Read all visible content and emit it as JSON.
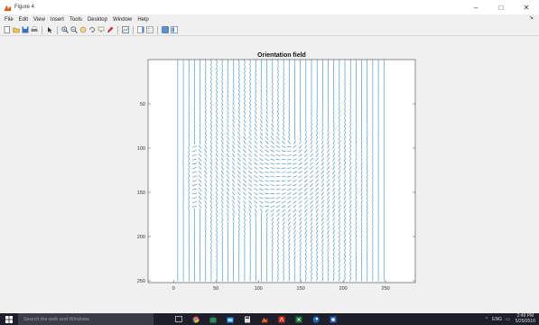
{
  "window": {
    "title": "Figure 4",
    "icon": "matlab-figure-icon",
    "controls": [
      {
        "name": "minimize",
        "glyph": "–"
      },
      {
        "name": "maximize",
        "glyph": "□"
      },
      {
        "name": "close",
        "glyph": "✕"
      }
    ]
  },
  "menubar": {
    "items": [
      "File",
      "Edit",
      "View",
      "Insert",
      "Tools",
      "Desktop",
      "Window",
      "Help"
    ],
    "overflow_glyph": "↘"
  },
  "toolbar": {
    "buttons": [
      "new-figure-icon",
      "open-file-icon",
      "save-icon",
      "print-icon",
      "separator",
      "edit-plot-icon",
      "separator",
      "zoom-in-icon",
      "zoom-out-icon",
      "pan-icon",
      "rotate-3d-icon",
      "data-cursor-icon",
      "brush-icon",
      "separator",
      "link-plot-icon",
      "separator",
      "colorbar-icon",
      "legend-icon",
      "separator",
      "hide-plot-tools-icon",
      "show-plot-tools-icon"
    ]
  },
  "chart_data": {
    "type": "quiver",
    "title": "Orientation field",
    "xlabel": "",
    "ylabel": "",
    "xlim": [
      -30,
      285
    ],
    "ylim": [
      0,
      252
    ],
    "y_direction": "reversed",
    "x_ticks": [
      0,
      50,
      100,
      150,
      200,
      250
    ],
    "y_ticks": [
      50,
      100,
      150,
      200,
      250
    ],
    "grid": false,
    "box": true,
    "series_color": "#2a7ab8",
    "field": {
      "x_range": [
        5,
        248
      ],
      "y_range": [
        2,
        248
      ],
      "columns": 38,
      "rows": 52,
      "vortex_centers": [
        [
          138,
          95
        ],
        [
          108,
          170
        ]
      ],
      "description_values": "unit orientation vectors arranged in two swirling loops"
    }
  },
  "taskbar": {
    "search_placeholder": "Search the web and Windows",
    "apps": [
      "task-view-icon",
      "chrome-icon",
      "store-icon",
      "explorer-icon",
      "calculator-icon",
      "matlab-icon",
      "acrobat-icon",
      "excel-icon",
      "steam-icon",
      "app-icon"
    ],
    "tray": {
      "network": "⌃",
      "volume": "ENG",
      "time": "2:49 PM",
      "date": "5/29/2016"
    }
  },
  "colors": {
    "accent": "#2a7ab8",
    "taskbar": "#1e1f2a",
    "figure_bg": "#f0f0f0",
    "axes_bg": "#ffffff"
  }
}
